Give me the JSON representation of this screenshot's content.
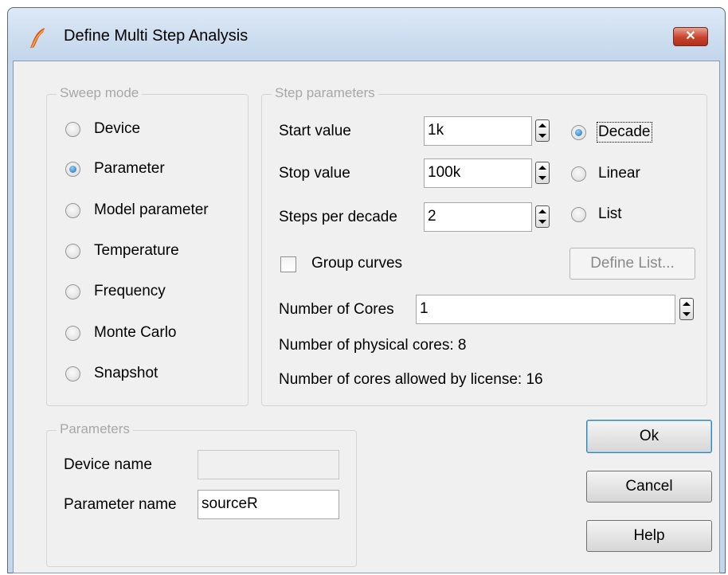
{
  "window": {
    "title": "Define Multi Step Analysis",
    "close_label": "✕"
  },
  "sweep_mode": {
    "title": "Sweep mode",
    "options": [
      {
        "label": "Device",
        "checked": false
      },
      {
        "label": "Parameter",
        "checked": true
      },
      {
        "label": "Model parameter",
        "checked": false
      },
      {
        "label": "Temperature",
        "checked": false
      },
      {
        "label": "Frequency",
        "checked": false
      },
      {
        "label": "Monte Carlo",
        "checked": false
      },
      {
        "label": "Snapshot",
        "checked": false
      }
    ]
  },
  "step_parameters": {
    "title": "Step parameters",
    "start_value_label": "Start value",
    "start_value": "1k",
    "stop_value_label": "Stop value",
    "stop_value": "100k",
    "steps_per_decade_label": "Steps per decade",
    "steps_per_decade": "2",
    "scale_options": [
      {
        "label": "Decade",
        "checked": true
      },
      {
        "label": "Linear",
        "checked": false
      },
      {
        "label": "List",
        "checked": false
      }
    ],
    "group_curves_label": "Group curves",
    "group_curves_checked": false,
    "define_list_label": "Define List...",
    "number_of_cores_label": "Number of Cores",
    "number_of_cores": "1",
    "physical_cores_text": "Number of physical cores: 8",
    "license_cores_text": "Number of cores allowed by license: 16"
  },
  "parameters": {
    "title": "Parameters",
    "device_name_label": "Device name",
    "device_name_value": "",
    "parameter_name_label": "Parameter name",
    "parameter_name_value": "sourceR"
  },
  "buttons": {
    "ok": "Ok",
    "cancel": "Cancel",
    "help": "Help"
  },
  "colors": {
    "title_bar": "#c4d7ec",
    "close_button": "#c9422c",
    "dialog_background": "#f0f0f0",
    "radio_selected": "#1c69b5"
  }
}
